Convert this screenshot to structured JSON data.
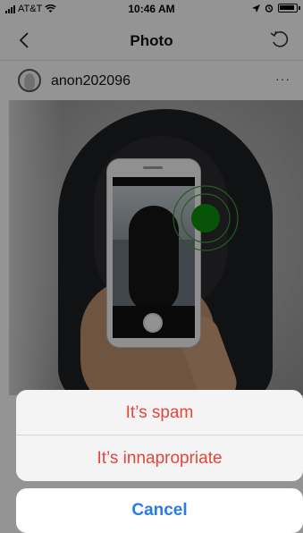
{
  "status_bar": {
    "carrier": "AT&T",
    "time": "10:46 AM"
  },
  "nav": {
    "title": "Photo"
  },
  "post": {
    "username": "anon202096",
    "more_label": "···"
  },
  "action_sheet": {
    "options": [
      {
        "label": "It’s spam",
        "color": "#e5453a"
      },
      {
        "label": "It’s innapropriate",
        "color": "#e5453a"
      }
    ],
    "cancel_label": "Cancel",
    "cancel_color": "#2a7be4"
  },
  "icons": {
    "back": "chevron-left-icon",
    "refresh": "refresh-icon",
    "more": "ellipsis-icon"
  }
}
